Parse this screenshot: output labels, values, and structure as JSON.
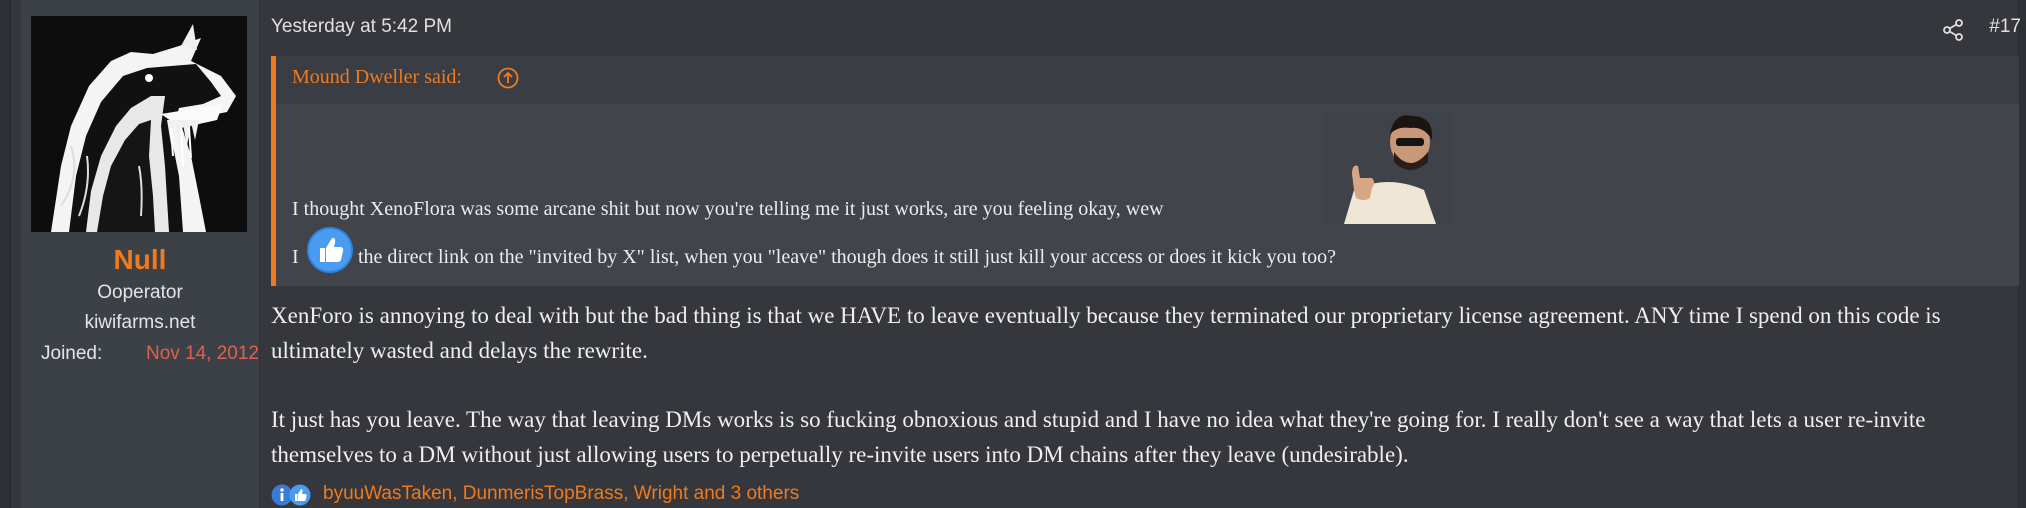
{
  "user": {
    "name": "Null",
    "title": "Ooperator",
    "site": "kiwifarms.net",
    "joined_label": "Joined:",
    "joined_value": "Nov 14, 2012"
  },
  "post": {
    "date": "Yesterday at 5:42 PM",
    "number": "#17",
    "share_icon": "share-icon"
  },
  "quote": {
    "author": "Mound Dweller said:",
    "jump_icon": "arrow-up-circle-icon",
    "line1": "I thought XenoFlora was some arcane shit but now you're telling me it just works, are you feeling okay, wew",
    "line2_prefix": "I",
    "line2_rest": "the direct link on the \"invited by X\" list, when you \"leave\" though does it still just kill your access or does it kick you too?"
  },
  "body": {
    "para1": "XenForo is annoying to deal with but the bad thing is that we HAVE to leave eventually because they terminated our proprietary license agreement. ANY time I spend on this code is ultimately wasted and delays the rewrite.",
    "para2": "It just has you leave. The way that leaving DMs works is so fucking obnoxious and stupid and I have no idea what they're going for. I really don't see a way that lets a user re-invite themselves to a DM without just allowing users to perpetually re-invite users into DM chains after they leave (undesirable)."
  },
  "reactions": {
    "list": "byuuWasTaken, DunmerisTopBrass, Wright and 3 others"
  },
  "colors": {
    "accent": "#f07a1c",
    "joined_date": "#e0614d",
    "background": "#35373c",
    "sidebar": "#3c4047",
    "quote_bg": "#41444b"
  }
}
